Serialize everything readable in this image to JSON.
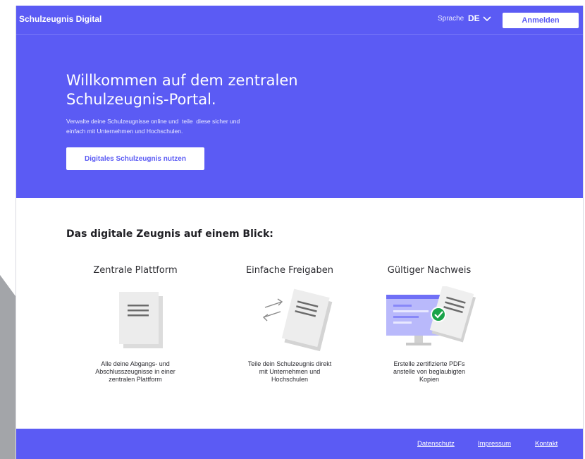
{
  "header": {
    "brand": "Schulzeugnis Digital",
    "language_label": "Sprache",
    "language_code": "DE",
    "login_label": "Anmelden"
  },
  "hero": {
    "title_line1": "Willkommen auf dem zentralen",
    "title_line2": "Schulzeugnis-Portal.",
    "subtitle_line1": "Verwalte deine Schulzeugnisse online und  teile  diese sicher und",
    "subtitle_line2": "einfach mit Unternehmen und Hochschulen.",
    "cta_label": "Digitales Schulzeugnis nutzen"
  },
  "features": {
    "section_title": "Das digitale Zeugnis auf einem Blick:",
    "items": [
      {
        "title": "Zentrale Plattform",
        "desc_line1": "Alle deine Abgangs- und",
        "desc_line2": "Abschlusszeugnisse in einer",
        "desc_line3": "zentralen Plattform",
        "icon": "document-stack-icon"
      },
      {
        "title": "Einfache Freigaben",
        "desc_line1": "Teile dein Schulzeugnis direkt",
        "desc_line2": "mit Unternehmen und",
        "desc_line3": "Hochschulen",
        "icon": "share-arrows-icon"
      },
      {
        "title": "Gültiger Nachweis",
        "desc_line1": "Erstelle zertifizierte PDFs",
        "desc_line2": "anstelle von beglaubigten",
        "desc_line3": "Kopien",
        "icon": "verified-document-icon"
      }
    ]
  },
  "footer": {
    "links": [
      "Datenschutz",
      "Impressum",
      "Kontakt"
    ]
  },
  "colors": {
    "brand": "#5b5bf4",
    "check": "#1aa34a",
    "backdrop_gray": "#a3a5a9"
  }
}
